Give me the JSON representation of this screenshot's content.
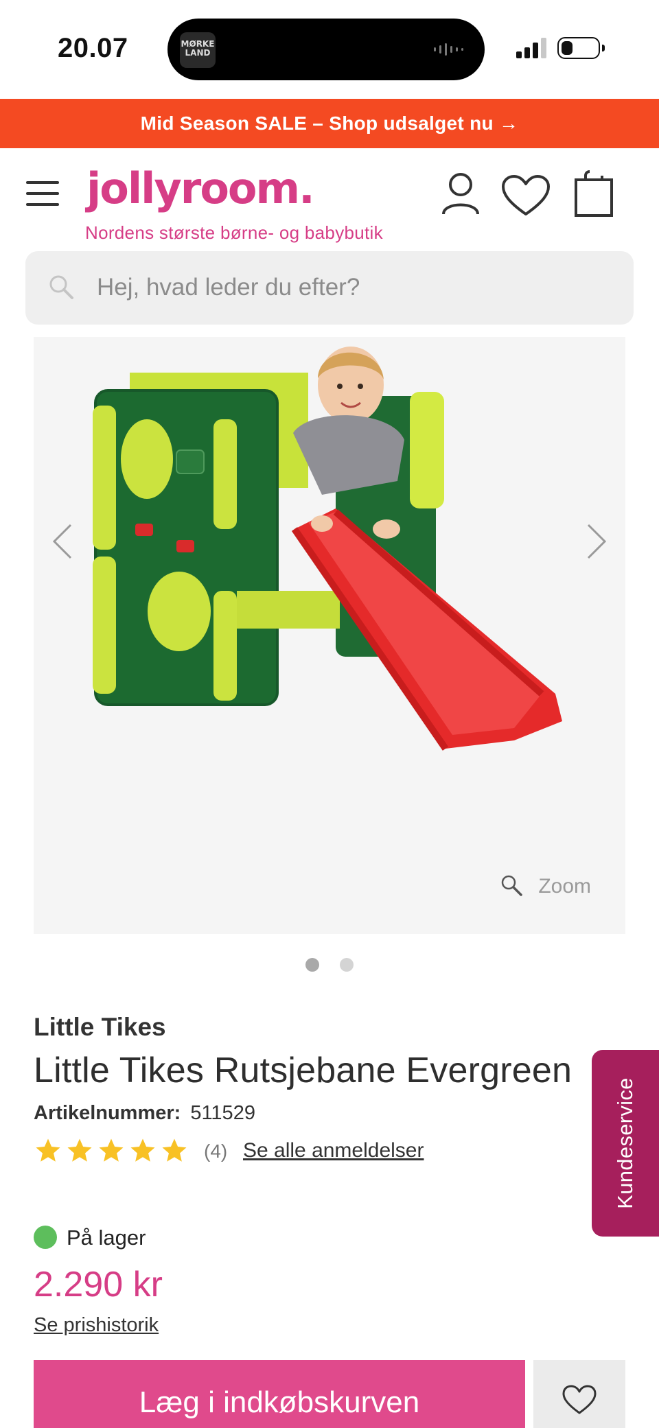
{
  "status_bar": {
    "time": "20.07",
    "now_playing_art": "MØRKE LAND"
  },
  "promo": {
    "text": "Mid Season SALE – Shop udsalget nu →"
  },
  "header": {
    "logo": "jollyroom.",
    "tagline": "Nordens største børne- og babybutik",
    "icons": [
      "menu-icon",
      "account-icon",
      "heart-icon",
      "shopping-bag-icon"
    ]
  },
  "search": {
    "placeholder": "Hej, hvad leder du efter?"
  },
  "gallery": {
    "zoom_label": "Zoom",
    "image_count": 2,
    "active_index": 0
  },
  "product": {
    "brand": "Little Tikes",
    "title": "Little Tikes Rutsjebane Evergreen",
    "article_label": "Artikelnummer:",
    "article_number": "511529",
    "rating": 5,
    "review_count": "(4)",
    "reviews_link": "Se alle anmeldelser",
    "stock": "På lager",
    "price": "2.290 kr",
    "price_history_link": "Se prishistorik",
    "add_to_cart": "Læg i indkøbskurven"
  },
  "customer_service": {
    "label": "Kundeservice"
  },
  "colors": {
    "brand_pink": "#d63d86",
    "promo_orange": "#f44a22",
    "stock_green": "#5dbe5c",
    "service_burgundy": "#a61f5c",
    "star_yellow": "#f8c125"
  }
}
